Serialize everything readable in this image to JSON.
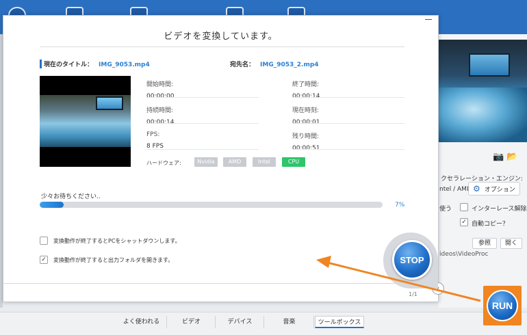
{
  "dialog": {
    "title": "ビデオを変換しています。",
    "current_title_label": "現在のタイトル：",
    "current_title_value": "IMG_9053.mp4",
    "destination_label": "宛先名：",
    "destination_value": "IMG_9053_2.mp4",
    "stats": {
      "start_time": {
        "label": "開始時間:",
        "value": "00:00:00"
      },
      "end_time": {
        "label": "終了時間:",
        "value": "00:00:14"
      },
      "duration": {
        "label": "持続時間:",
        "value": "00:00:14"
      },
      "current_time": {
        "label": "現在時刻:",
        "value": "00:00:01"
      },
      "fps": {
        "label": "FPS:",
        "value": "8 FPS"
      },
      "remaining_time": {
        "label": "残り時間:",
        "value": "00:00:51"
      }
    },
    "hardware": {
      "label": "ハードウェア:",
      "badges": [
        "Nvidia",
        "AMD",
        "Intel",
        "CPU"
      ],
      "active": "CPU",
      "active_color": "#2ec56b"
    },
    "progress": {
      "wait_label": "少々お待ちください..",
      "percent_text": "7%",
      "fraction": 0.07
    },
    "options": [
      {
        "label": "変換動作が終了するとPCをシャットダウンします。",
        "checked": false
      },
      {
        "label": "変換動作が終了すると出力フォルダを開きます。",
        "checked": true
      }
    ],
    "page_count": "1/1",
    "stop_label": "STOP"
  },
  "right_panel": {
    "accel_label": "クセラレーション・エンジン:",
    "intel_amd": "ntel / AMD",
    "option_button": "オプション",
    "use_label": "使う",
    "deinterlace_label": "インターレース解除",
    "auto_copy_label": "自動コピー？",
    "browse_button": "参照",
    "open_button": "開く",
    "path_text": "ideos\\VideoProc",
    "run_label": "RUN"
  },
  "bottom_tabs": [
    "よく使われる",
    "ビデオ",
    "デバイス",
    "音楽",
    "ツールボックス"
  ],
  "active_tab": "ツールボックス",
  "colors": {
    "accent_blue": "#2b6fc1",
    "highlight_orange": "#f08521"
  }
}
